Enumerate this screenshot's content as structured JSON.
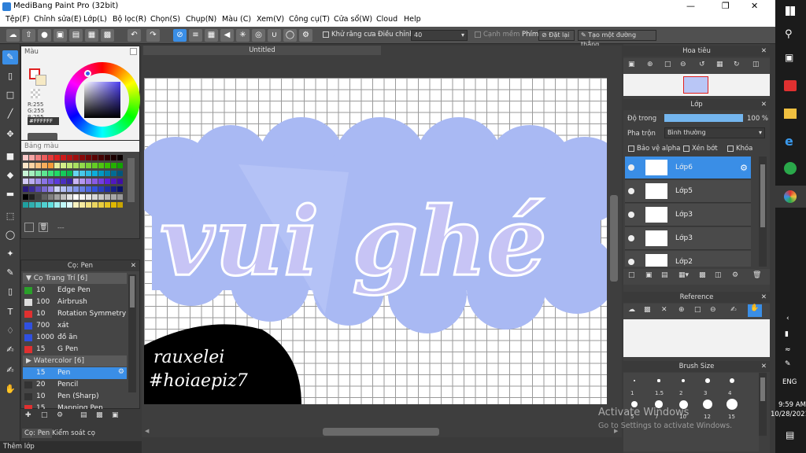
{
  "window": {
    "title": "MediBang Paint Pro (32bit)",
    "doc_tab": "Untitled"
  },
  "menu": [
    "Tệp(F)",
    "Chỉnh sửa(E)",
    "Lớp(L)",
    "Bộ lọc(R)",
    "Chọn(S)",
    "Chụp(N)",
    "Màu (C)",
    "Xem(V)",
    "Công cụ(T)",
    "Cửa sổ(W)",
    "Cloud",
    "Help"
  ],
  "toolbar": {
    "antialias_label": "Khử răng cưa",
    "adjust_label": "Điều chỉnh",
    "adjust_value": "40",
    "edge_label": "Cạnh mềm",
    "key_label": "Phím",
    "reset_label": "Đặt lại",
    "create_line_label": "Tạo một đường thẳng"
  },
  "color_panel": {
    "title": "Màu",
    "r": "R:255",
    "g": "G:255",
    "b": "B:255",
    "hex": "#FFFFFF",
    "palette_title": "Bảng màu"
  },
  "navigator": {
    "title": "Hoa tiêu"
  },
  "layer_panel": {
    "title": "Lớp",
    "opacity_label": "Độ trong",
    "opacity_value": "100 %",
    "opacity_fraction": 1.0,
    "blend_label": "Pha trộn",
    "blend_value": "Bình thường",
    "protect_alpha": "Bảo vệ alpha",
    "clip": "Xén bớt",
    "lock": "Khóa",
    "layers": [
      {
        "name": "Lớp6",
        "selected": true
      },
      {
        "name": "Lớp5",
        "selected": false
      },
      {
        "name": "Lớp3",
        "selected": false
      },
      {
        "name": "Lớp3",
        "selected": false
      },
      {
        "name": "Lớp2",
        "selected": false
      }
    ]
  },
  "reference": {
    "title": "Reference"
  },
  "brush_size": {
    "title": "Brush Size",
    "row1": [
      "1",
      "1.5",
      "2",
      "3",
      "4"
    ],
    "row2": [
      "5",
      "7",
      "10",
      "12",
      "15"
    ]
  },
  "brush_panel": {
    "title": "Cọ: Pen",
    "group1": "Cọ Trang Trí [6]",
    "group2": "Watercolor [6]",
    "items1": [
      {
        "size": "10",
        "name": "Edge Pen",
        "color": "#2aa02a"
      },
      {
        "size": "100",
        "name": "Airbrush",
        "color": "#dddddd"
      },
      {
        "size": "10",
        "name": "Rotation Symmetry",
        "color": "#e03030"
      },
      {
        "size": "700",
        "name": "xát",
        "color": "#3050e0"
      },
      {
        "size": "1000",
        "name": "đồ ăn",
        "color": "#3050e0"
      },
      {
        "size": "15",
        "name": "G Pen",
        "color": "#e03030"
      }
    ],
    "items2": [
      {
        "size": "15",
        "name": "Pen",
        "color": "#3a8ee6",
        "selected": true
      },
      {
        "size": "20",
        "name": "Pencil",
        "color": "#333333"
      },
      {
        "size": "10",
        "name": "Pen (Sharp)",
        "color": "#333333"
      },
      {
        "size": "15",
        "name": "Mapping Pen",
        "color": "#e03030"
      }
    ]
  },
  "bottom_tabs": {
    "tab1": "Cọ: Pen",
    "tab2": "Kiểm soát cọ",
    "add_layer": "Thêm lớp"
  },
  "canvas_art": {
    "main_text": "vui ghé",
    "signature1": "rauxelei",
    "signature2": "#hoiaepiz7"
  },
  "watermark": {
    "line1": "Activate Windows",
    "line2": "Go to Settings to activate Windows."
  },
  "taskbar": {
    "lang": "ENG",
    "time": "9:59 AM",
    "date": "10/28/2021"
  },
  "colors": {
    "accent": "#3a8ee6",
    "blob": "#a9b9f3",
    "letter": "#c7c4f5"
  }
}
